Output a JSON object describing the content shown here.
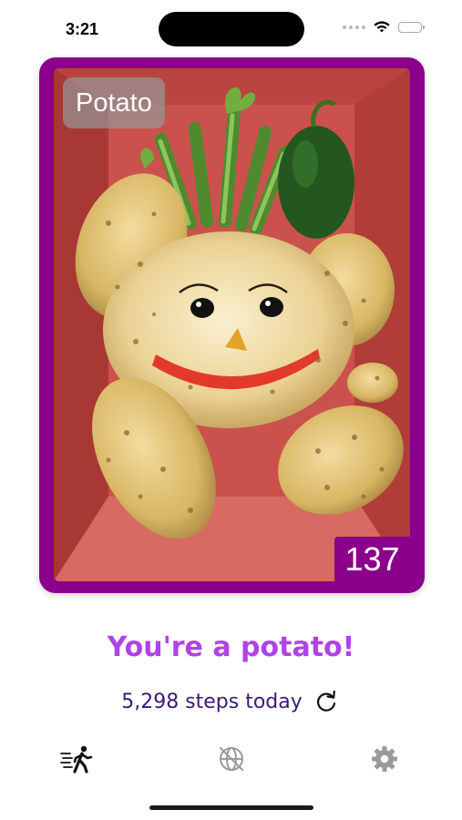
{
  "status_bar": {
    "time": "3:21"
  },
  "card": {
    "name": "Potato",
    "score": "137",
    "border_color": "#8b008b",
    "image_subject": "potato-character-image"
  },
  "headline": "You're a potato!",
  "steps": {
    "text": "5,298 steps today",
    "refresh_icon": "refresh-icon"
  },
  "tab_bar": {
    "items": [
      {
        "icon": "walking-person-icon",
        "selected": true
      },
      {
        "icon": "globe-crossed-icon",
        "selected": false
      },
      {
        "icon": "gear-icon",
        "selected": false
      }
    ]
  },
  "colors": {
    "accent": "#b043e6",
    "steps_text": "#3c1a78",
    "card_border": "#8b008b",
    "tab_inactive": "#9a9a9a"
  }
}
